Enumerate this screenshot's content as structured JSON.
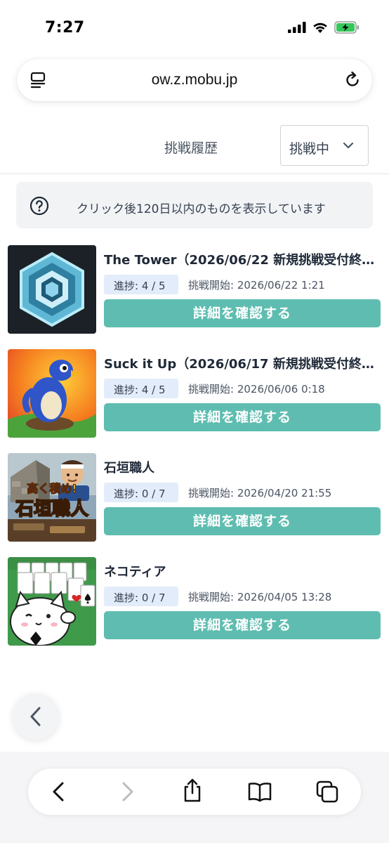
{
  "status_bar": {
    "time": "7:27"
  },
  "browser": {
    "url": "ow.z.mobu.jp"
  },
  "header": {
    "history_label": "挑戦履歴",
    "status_select": "挑戦中"
  },
  "notice": {
    "text": "クリック後120日以内のものを表示しています"
  },
  "challenges": [
    {
      "title": "The Tower（2026/06/22 新規挑戦受付終了）",
      "progress": "進捗: 4 / 5",
      "start": "挑戦開始: 2026/06/22 1:21",
      "button": "詳細を確認する"
    },
    {
      "title": "Suck it Up（2026/06/17 新規挑戦受付終了）",
      "progress": "進捗: 4 / 5",
      "start": "挑戦開始: 2026/06/06 0:18",
      "button": "詳細を確認する"
    },
    {
      "title": "石垣職人",
      "progress": "進捗: 0 / 7",
      "start": "挑戦開始: 2026/04/20 21:55",
      "button": "詳細を確認する"
    },
    {
      "title": "ネコティア",
      "progress": "進捗: 0 / 7",
      "start": "挑戦開始: 2026/04/05 13:28",
      "button": "詳細を確認する"
    }
  ],
  "thumbnail_texts": {
    "stone_game_logo_top": "高く積め!",
    "stone_game_logo_main": "石垣職人"
  },
  "colors": {
    "accent": "#5ebdb0",
    "badge_bg": "#e3ecfa"
  },
  "icons": [
    "signal-icon",
    "wifi-icon",
    "battery-charging-icon",
    "tab-overview-icon",
    "reload-icon",
    "chevron-down-icon",
    "help-circle-icon",
    "chevron-left-icon",
    "back-icon",
    "forward-icon",
    "share-icon",
    "bookmarks-icon",
    "tabs-icon"
  ]
}
